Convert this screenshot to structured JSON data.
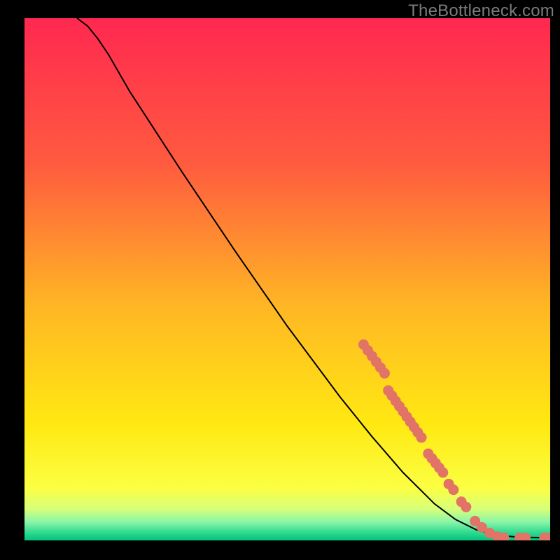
{
  "watermark": "TheBottleneck.com",
  "colors": {
    "gradient_stops": [
      {
        "offset": 0.0,
        "color": "#ff2850"
      },
      {
        "offset": 0.28,
        "color": "#ff5b3f"
      },
      {
        "offset": 0.55,
        "color": "#ffb624"
      },
      {
        "offset": 0.78,
        "color": "#ffe912"
      },
      {
        "offset": 0.9,
        "color": "#fbff42"
      },
      {
        "offset": 0.94,
        "color": "#d7ff7a"
      },
      {
        "offset": 0.965,
        "color": "#88f5a8"
      },
      {
        "offset": 0.985,
        "color": "#2fd98f"
      },
      {
        "offset": 1.0,
        "color": "#00c47a"
      }
    ],
    "line": "#000000",
    "marker_fill": "#e17367",
    "marker_stroke": "#e17367"
  },
  "chart_data": {
    "type": "line",
    "title": "",
    "xlabel": "",
    "ylabel": "",
    "xlim": [
      0,
      100
    ],
    "ylim": [
      0,
      100
    ],
    "curve": {
      "name": "curve",
      "points": [
        {
          "x": 10.0,
          "y": 100.0
        },
        {
          "x": 12.0,
          "y": 98.5
        },
        {
          "x": 14.0,
          "y": 96.0
        },
        {
          "x": 16.0,
          "y": 93.0
        },
        {
          "x": 18.0,
          "y": 89.5
        },
        {
          "x": 20.0,
          "y": 86.0
        },
        {
          "x": 30.0,
          "y": 70.5
        },
        {
          "x": 40.0,
          "y": 55.5
        },
        {
          "x": 50.0,
          "y": 41.0
        },
        {
          "x": 60.0,
          "y": 27.5
        },
        {
          "x": 66.0,
          "y": 20.0
        },
        {
          "x": 72.0,
          "y": 13.0
        },
        {
          "x": 78.0,
          "y": 7.0
        },
        {
          "x": 82.0,
          "y": 4.0
        },
        {
          "x": 86.0,
          "y": 2.0
        },
        {
          "x": 90.0,
          "y": 1.0
        },
        {
          "x": 94.0,
          "y": 0.6
        },
        {
          "x": 100.0,
          "y": 0.5
        }
      ]
    },
    "markers": {
      "name": "highlighted-points",
      "points": [
        {
          "x": 64.5,
          "y": 37.5
        },
        {
          "x": 65.3,
          "y": 36.4
        },
        {
          "x": 66.1,
          "y": 35.3
        },
        {
          "x": 66.9,
          "y": 34.2
        },
        {
          "x": 67.7,
          "y": 33.1
        },
        {
          "x": 68.5,
          "y": 32.0
        },
        {
          "x": 69.2,
          "y": 28.7
        },
        {
          "x": 69.9,
          "y": 27.7
        },
        {
          "x": 70.6,
          "y": 26.7
        },
        {
          "x": 71.3,
          "y": 25.7
        },
        {
          "x": 72.0,
          "y": 24.7
        },
        {
          "x": 72.7,
          "y": 23.7
        },
        {
          "x": 73.4,
          "y": 22.7
        },
        {
          "x": 74.1,
          "y": 21.7
        },
        {
          "x": 74.8,
          "y": 20.7
        },
        {
          "x": 75.5,
          "y": 19.7
        },
        {
          "x": 76.8,
          "y": 16.6
        },
        {
          "x": 77.5,
          "y": 15.7
        },
        {
          "x": 78.2,
          "y": 14.8
        },
        {
          "x": 78.9,
          "y": 13.9
        },
        {
          "x": 79.6,
          "y": 13.0
        },
        {
          "x": 80.7,
          "y": 10.8
        },
        {
          "x": 81.6,
          "y": 9.7
        },
        {
          "x": 83.1,
          "y": 7.4
        },
        {
          "x": 84.0,
          "y": 6.4
        },
        {
          "x": 85.7,
          "y": 3.7
        },
        {
          "x": 87.0,
          "y": 2.5
        },
        {
          "x": 88.5,
          "y": 1.4
        },
        {
          "x": 90.0,
          "y": 0.7
        },
        {
          "x": 91.2,
          "y": 0.5
        },
        {
          "x": 94.2,
          "y": 0.5
        },
        {
          "x": 95.3,
          "y": 0.5
        },
        {
          "x": 98.9,
          "y": 0.5
        },
        {
          "x": 100.0,
          "y": 0.5
        }
      ],
      "radius": 7
    }
  }
}
